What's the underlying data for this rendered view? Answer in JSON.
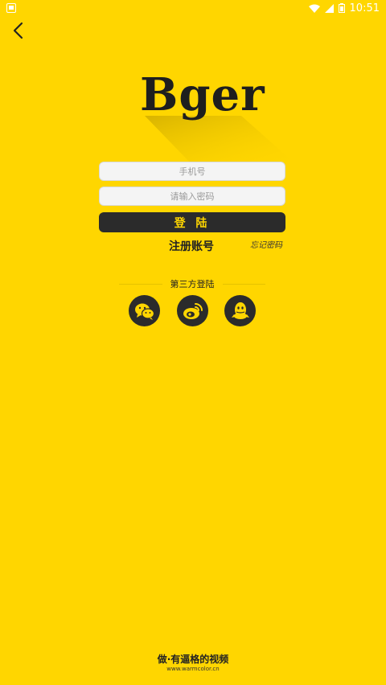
{
  "status_bar": {
    "time": "10:51"
  },
  "logo": {
    "text": "Bger"
  },
  "form": {
    "phone_placeholder": "手机号",
    "password_placeholder": "请输入密码",
    "login_label": "登 陆",
    "register_label": "注册账号",
    "forgot_label": "忘记密码"
  },
  "third_party": {
    "title": "第三方登陆",
    "providers": [
      {
        "icon": "wechat-icon"
      },
      {
        "icon": "weibo-icon"
      },
      {
        "icon": "qq-icon"
      }
    ]
  },
  "footer": {
    "slogan": "做·有逼格的视频",
    "url": "www.warmcolor.cn"
  },
  "colors": {
    "background": "#FFD600",
    "dark": "#2B2B2B",
    "accent_text": "#FFD600"
  }
}
